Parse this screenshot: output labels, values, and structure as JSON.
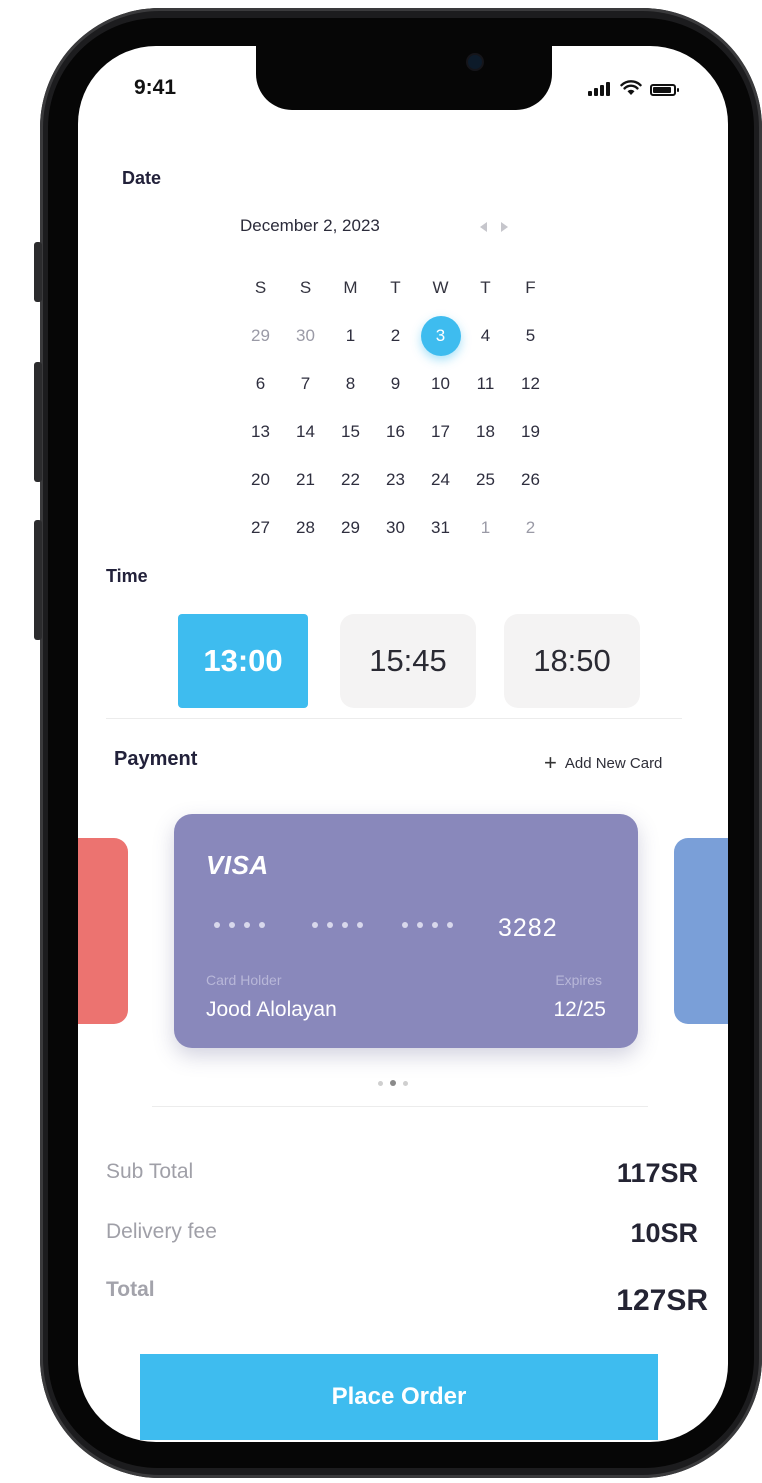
{
  "status_bar": {
    "time": "9:41"
  },
  "date_section": {
    "label": "Date",
    "month_title": "December 2, 2023",
    "weekdays": [
      "S",
      "S",
      "M",
      "T",
      "W",
      "T",
      "F"
    ],
    "weeks": [
      [
        {
          "d": "29",
          "m": true
        },
        {
          "d": "30",
          "m": true
        },
        {
          "d": "1"
        },
        {
          "d": "2"
        },
        {
          "d": "3",
          "sel": true
        },
        {
          "d": "4"
        },
        {
          "d": "5"
        }
      ],
      [
        {
          "d": "6"
        },
        {
          "d": "7"
        },
        {
          "d": "8"
        },
        {
          "d": "9"
        },
        {
          "d": "10"
        },
        {
          "d": "11"
        },
        {
          "d": "12"
        }
      ],
      [
        {
          "d": "13"
        },
        {
          "d": "14"
        },
        {
          "d": "15"
        },
        {
          "d": "16"
        },
        {
          "d": "17"
        },
        {
          "d": "18"
        },
        {
          "d": "19"
        }
      ],
      [
        {
          "d": "20"
        },
        {
          "d": "21"
        },
        {
          "d": "22"
        },
        {
          "d": "23"
        },
        {
          "d": "24"
        },
        {
          "d": "25"
        },
        {
          "d": "26"
        }
      ],
      [
        {
          "d": "27"
        },
        {
          "d": "28"
        },
        {
          "d": "29"
        },
        {
          "d": "30"
        },
        {
          "d": "31"
        },
        {
          "d": "1",
          "m": true
        },
        {
          "d": "2",
          "m": true
        }
      ]
    ],
    "selected_day": "3"
  },
  "time_section": {
    "label": "Time",
    "slots": [
      "13:00",
      "15:45",
      "18:50"
    ],
    "selected": "13:00"
  },
  "payment": {
    "label": "Payment",
    "add_card_label": "Add New Card",
    "card": {
      "brand": "VISA",
      "last4": "3282",
      "holder_label": "Card Holder",
      "holder_name": "Jood Alolayan",
      "expires_label": "Expires",
      "expires": "12/25",
      "color": "#8988bb"
    },
    "side_card_colors": [
      "#ec7370",
      "#7a9fd8"
    ],
    "pager": {
      "count": 3,
      "active_index": 1
    }
  },
  "summary": {
    "subtotal_label": "Sub Total",
    "subtotal_value": "117SR",
    "delivery_label": "Delivery fee",
    "delivery_value": "10SR",
    "total_label": "Total",
    "total_value": "127SR"
  },
  "place_order_label": "Place Order",
  "colors": {
    "accent": "#3ebcef",
    "text": "#22213a",
    "muted": "#a0a0a8"
  }
}
